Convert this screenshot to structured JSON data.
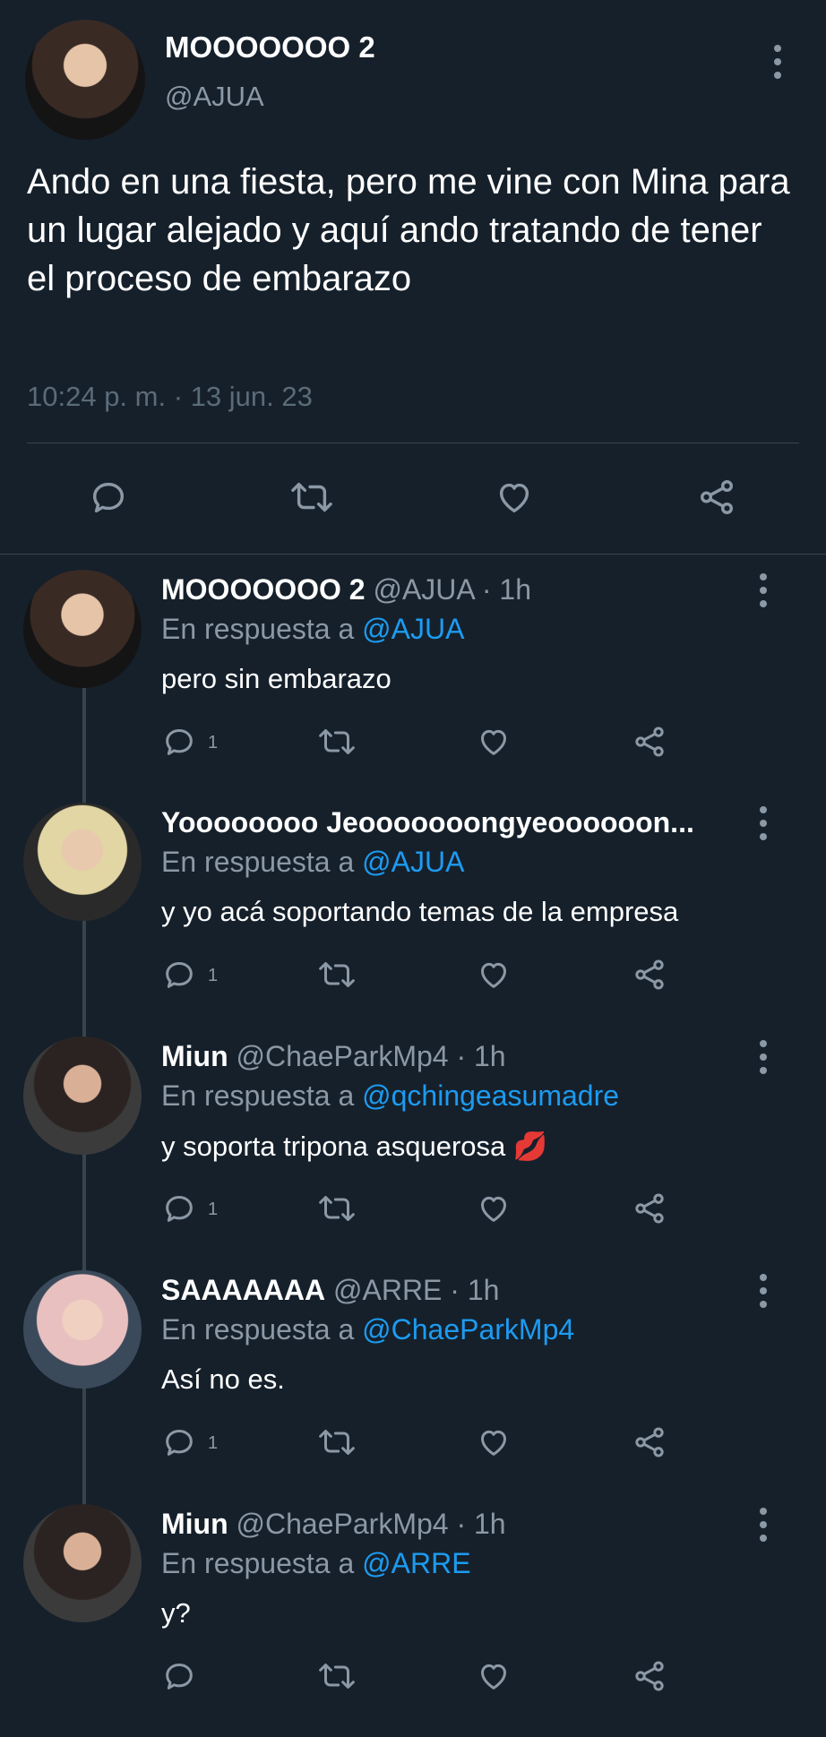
{
  "main": {
    "author_name": "MOOOOOOO 2",
    "author_handle": "@AJUA",
    "text": "Ando en una fiesta, pero me vine con Mina para un lugar alejado y aquí ando tratando de tener el proceso de embarazo",
    "timestamp": "10:24 p. m. · 13 jun. 23",
    "icons": [
      "comment-icon",
      "retweet-icon",
      "heart-icon",
      "share-icon"
    ]
  },
  "replies": [
    {
      "name": "MOOOOOOO 2",
      "meta": " @AJUA · 1h",
      "reply_prefix": "En respuesta a ",
      "reply_to": "@AJUA",
      "text": "pero sin embarazo",
      "reply_count": "1"
    },
    {
      "name": "Yoooooooo Jeooooooongyeoooooon...",
      "meta": "",
      "reply_prefix": "En respuesta a ",
      "reply_to": "@AJUA",
      "text": "y yo acá soportando temas de la empresa",
      "reply_count": "1"
    },
    {
      "name": "Miun",
      "meta": " @ChaeParkMp4 · 1h",
      "reply_prefix": "En respuesta a ",
      "reply_to": "@qchingeasumadre",
      "text": "y soporta tripona asquerosa 💋",
      "reply_count": "1"
    },
    {
      "name": "SAAAAAAA",
      "meta": " @ARRE · 1h",
      "reply_prefix": "En respuesta a ",
      "reply_to": "@ChaeParkMp4",
      "text": "Así no es.",
      "reply_count": "1"
    },
    {
      "name": "Miun",
      "meta": " @ChaeParkMp4 · 1h",
      "reply_prefix": "En respuesta a ",
      "reply_to": "@ARRE",
      "text": "y?",
      "reply_count": ""
    }
  ],
  "colors": {
    "background": "#15202b",
    "text_secondary": "#8b98a5",
    "link": "#1d9bf0",
    "divider": "#38444d"
  }
}
